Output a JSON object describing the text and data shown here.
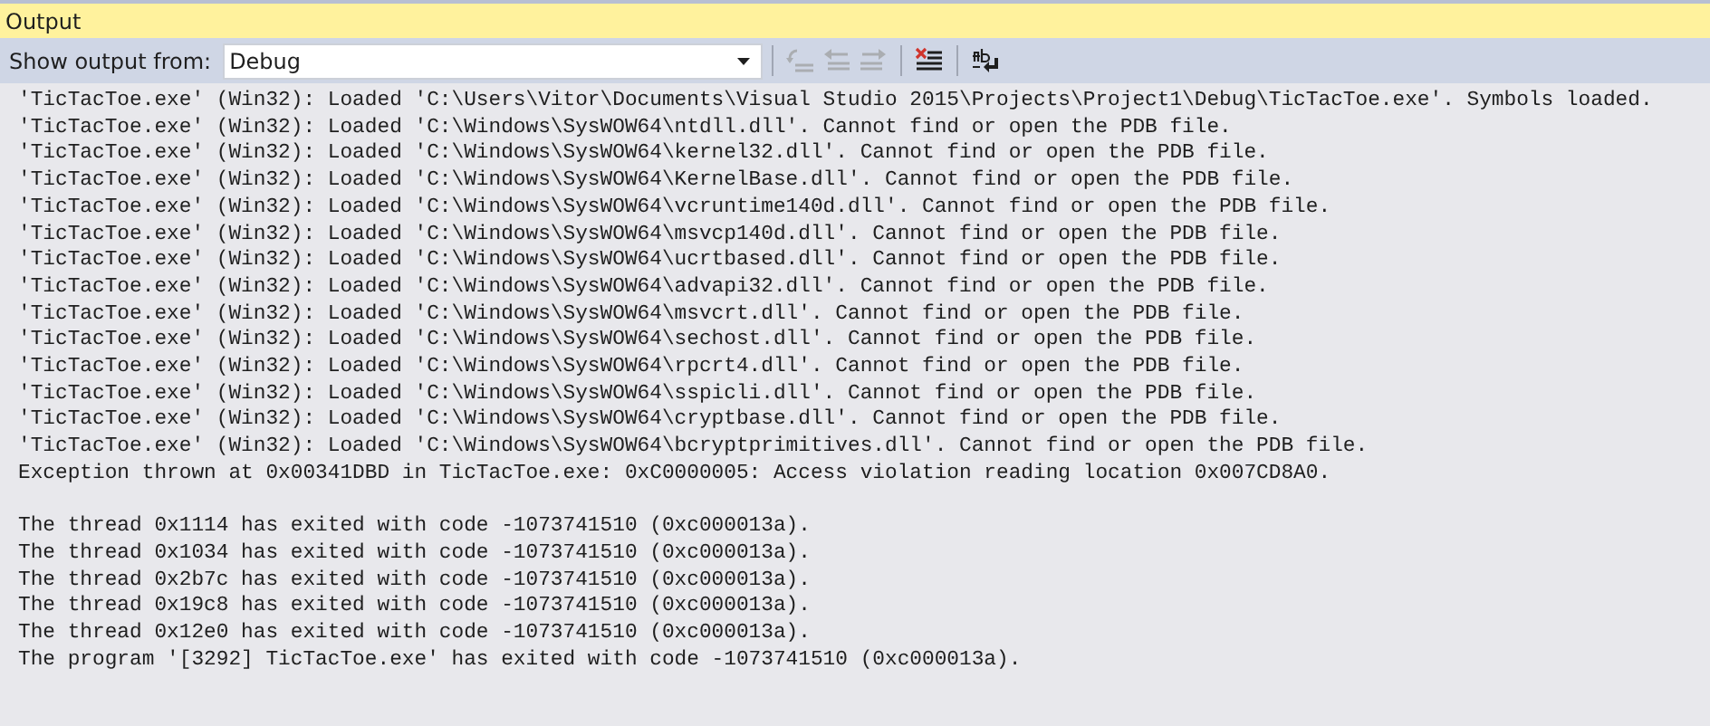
{
  "window": {
    "title": "Output"
  },
  "toolbar": {
    "label": "Show output from:",
    "source": "Debug",
    "buttons": [
      {
        "kind": "goto",
        "disabled": true
      },
      {
        "kind": "prev",
        "disabled": true
      },
      {
        "kind": "next",
        "disabled": true
      },
      {
        "kind": "clear",
        "disabled": false
      },
      {
        "kind": "wrap",
        "disabled": false
      }
    ]
  },
  "lines": [
    {
      "text": "'TicTacToe.exe' (Win32): Loaded 'C:\\Users\\Vitor\\Documents\\Visual Studio 2015\\Projects\\Project1\\Debug\\TicTacToe.exe'. Symbols loaded.",
      "gap_before": false
    },
    {
      "text": "'TicTacToe.exe' (Win32): Loaded 'C:\\Windows\\SysWOW64\\ntdll.dll'. Cannot find or open the PDB file.",
      "gap_before": false
    },
    {
      "text": "'TicTacToe.exe' (Win32): Loaded 'C:\\Windows\\SysWOW64\\kernel32.dll'. Cannot find or open the PDB file.",
      "gap_before": false
    },
    {
      "text": "'TicTacToe.exe' (Win32): Loaded 'C:\\Windows\\SysWOW64\\KernelBase.dll'. Cannot find or open the PDB file.",
      "gap_before": false
    },
    {
      "text": "'TicTacToe.exe' (Win32): Loaded 'C:\\Windows\\SysWOW64\\vcruntime140d.dll'. Cannot find or open the PDB file.",
      "gap_before": false
    },
    {
      "text": "'TicTacToe.exe' (Win32): Loaded 'C:\\Windows\\SysWOW64\\msvcp140d.dll'. Cannot find or open the PDB file.",
      "gap_before": false
    },
    {
      "text": "'TicTacToe.exe' (Win32): Loaded 'C:\\Windows\\SysWOW64\\ucrtbased.dll'. Cannot find or open the PDB file.",
      "gap_before": false
    },
    {
      "text": "'TicTacToe.exe' (Win32): Loaded 'C:\\Windows\\SysWOW64\\advapi32.dll'. Cannot find or open the PDB file.",
      "gap_before": false
    },
    {
      "text": "'TicTacToe.exe' (Win32): Loaded 'C:\\Windows\\SysWOW64\\msvcrt.dll'. Cannot find or open the PDB file.",
      "gap_before": false
    },
    {
      "text": "'TicTacToe.exe' (Win32): Loaded 'C:\\Windows\\SysWOW64\\sechost.dll'. Cannot find or open the PDB file.",
      "gap_before": false
    },
    {
      "text": "'TicTacToe.exe' (Win32): Loaded 'C:\\Windows\\SysWOW64\\rpcrt4.dll'. Cannot find or open the PDB file.",
      "gap_before": false
    },
    {
      "text": "'TicTacToe.exe' (Win32): Loaded 'C:\\Windows\\SysWOW64\\sspicli.dll'. Cannot find or open the PDB file.",
      "gap_before": false
    },
    {
      "text": "'TicTacToe.exe' (Win32): Loaded 'C:\\Windows\\SysWOW64\\cryptbase.dll'. Cannot find or open the PDB file.",
      "gap_before": false
    },
    {
      "text": "'TicTacToe.exe' (Win32): Loaded 'C:\\Windows\\SysWOW64\\bcryptprimitives.dll'. Cannot find or open the PDB file.",
      "gap_before": false
    },
    {
      "text": "Exception thrown at 0x00341DBD in TicTacToe.exe: 0xC0000005: Access violation reading location 0x007CD8A0.",
      "gap_before": false
    },
    {
      "text": "The thread 0x1114 has exited with code -1073741510 (0xc000013a).",
      "gap_before": true
    },
    {
      "text": "The thread 0x1034 has exited with code -1073741510 (0xc000013a).",
      "gap_before": false
    },
    {
      "text": "The thread 0x2b7c has exited with code -1073741510 (0xc000013a).",
      "gap_before": false
    },
    {
      "text": "The thread 0x19c8 has exited with code -1073741510 (0xc000013a).",
      "gap_before": false
    },
    {
      "text": "The thread 0x12e0 has exited with code -1073741510 (0xc000013a).",
      "gap_before": false
    },
    {
      "text": "The program '[3292] TicTacToe.exe' has exited with code -1073741510 (0xc000013a).",
      "gap_before": false
    }
  ]
}
